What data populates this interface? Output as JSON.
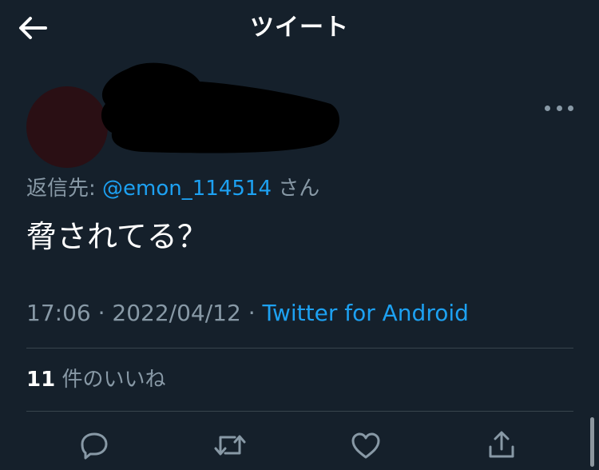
{
  "header": {
    "title": "ツイート",
    "back_icon": "arrow-left-icon"
  },
  "tweet": {
    "reply_prefix": "返信先: ",
    "reply_handle": "@emon_114514",
    "reply_suffix": " さん",
    "text": "脅されてる？",
    "time": "17:06",
    "separator": " · ",
    "date": "2022/04/12",
    "source": "Twitter for Android"
  },
  "stats": {
    "likes_count": "11",
    "likes_label": " 件のいいね"
  },
  "actions": {
    "reply": "reply-icon",
    "retweet": "retweet-icon",
    "like": "like-icon",
    "share": "share-icon"
  },
  "colors": {
    "background": "#15202b",
    "accent": "#1da1f2",
    "muted": "#8899a6",
    "divider": "#38444d"
  }
}
